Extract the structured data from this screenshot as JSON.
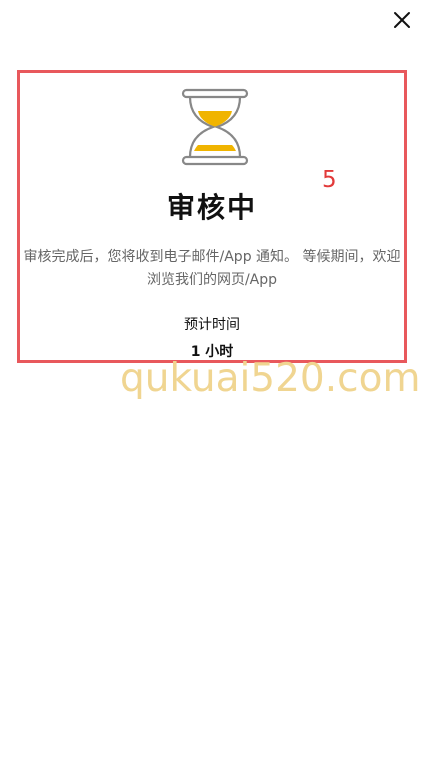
{
  "header": {
    "close_icon": "close-icon"
  },
  "review": {
    "icon": "hourglass-icon",
    "annotation_number": "5",
    "title": "审核中",
    "description": "审核完成后，您将收到电子邮件/App 通知。 等候期间，欢迎浏览我们的网页/App",
    "eta_label": "预计时间",
    "eta_value": "1 小时"
  },
  "watermark": {
    "text": "qukuai520.com"
  },
  "colors": {
    "highlight_border": "#e8585c",
    "sand": "#f0b400",
    "watermark": "#f0d591",
    "annotation": "#e23a3a"
  }
}
